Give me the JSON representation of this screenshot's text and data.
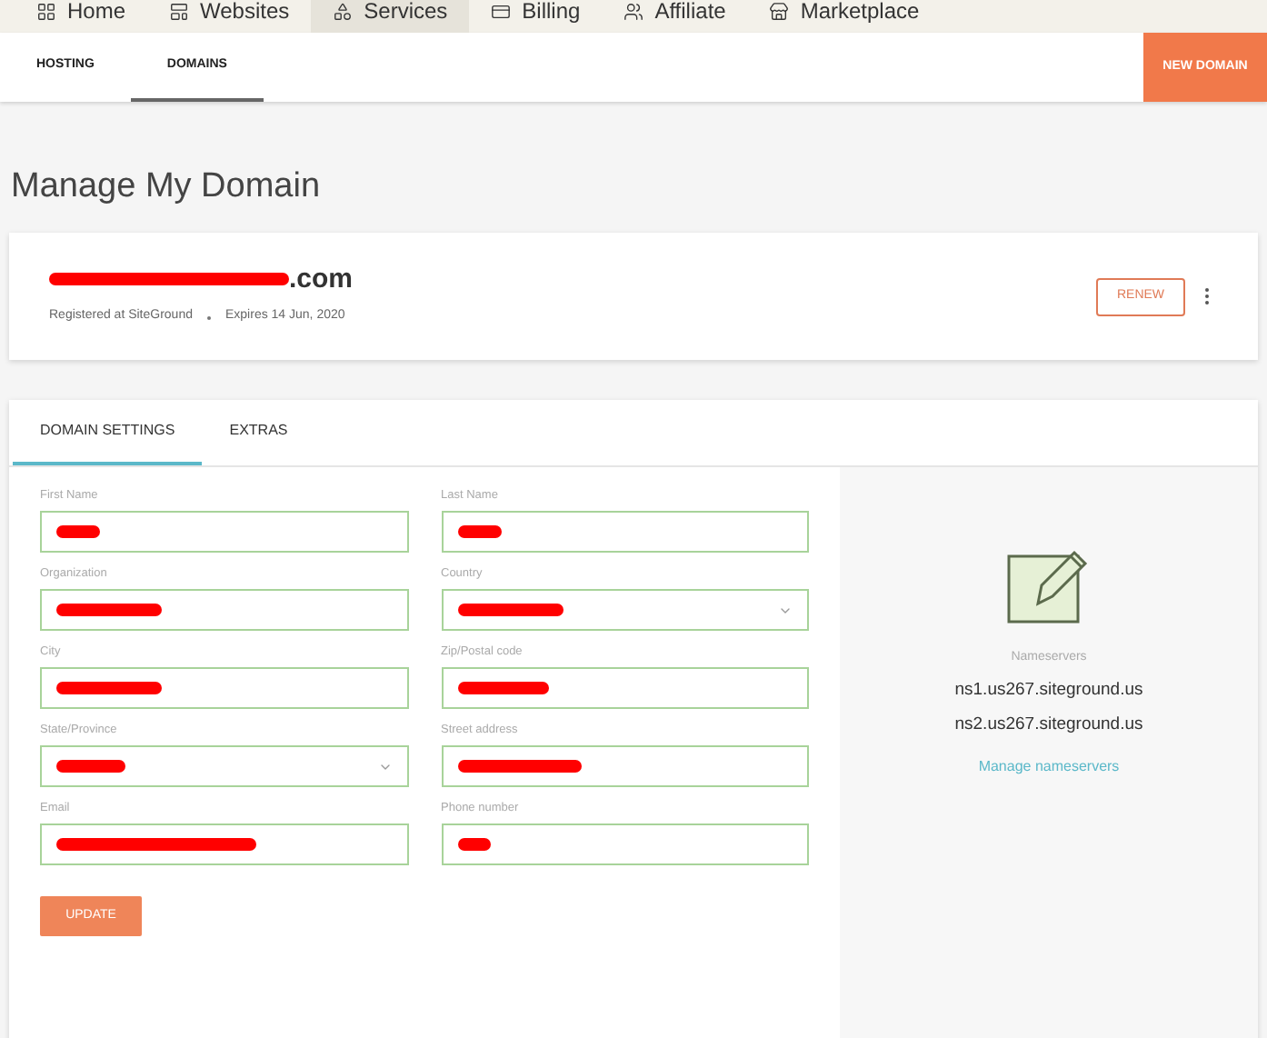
{
  "top_nav": [
    {
      "label": "Home",
      "selected": false
    },
    {
      "label": "Websites",
      "selected": false
    },
    {
      "label": "Services",
      "selected": true
    },
    {
      "label": "Billing",
      "selected": false
    },
    {
      "label": "Affiliate",
      "selected": false
    },
    {
      "label": "Marketplace",
      "selected": false
    }
  ],
  "sub_nav": {
    "tabs": [
      {
        "label": "HOSTING",
        "selected": false
      },
      {
        "label": "DOMAINS",
        "selected": true
      }
    ],
    "action": "NEW DOMAIN"
  },
  "page_title": "Manage My Domain",
  "domain_card": {
    "name": ".com",
    "redacted": true,
    "registrar": "Registered at SiteGround",
    "expires": "Expires 14 Jun, 2020",
    "action": "RENEW"
  },
  "settings_tabs": [
    {
      "label": "DOMAIN SETTINGS",
      "selected": true
    },
    {
      "label": "EXTRAS",
      "selected": false
    }
  ],
  "fields": [
    {
      "label": "First Name",
      "kind": "text",
      "redacted": true
    },
    {
      "label": "Last Name",
      "kind": "text",
      "redacted": true
    },
    {
      "label": "Organization",
      "kind": "text",
      "redacted": true
    },
    {
      "label": "Country",
      "kind": "select",
      "redacted": true
    },
    {
      "label": "City",
      "kind": "text",
      "redacted": true
    },
    {
      "label": "Zip/Postal code",
      "kind": "text",
      "redacted": true
    },
    {
      "label": "State/Province",
      "kind": "select",
      "redacted": true
    },
    {
      "label": "Street address",
      "kind": "text",
      "redacted": true
    },
    {
      "label": "Email",
      "kind": "text",
      "redacted": true
    },
    {
      "label": "Phone number",
      "kind": "text",
      "redacted": true
    }
  ],
  "update_button": "UPDATE",
  "nameservers": {
    "label": "Nameservers",
    "servers": [
      "ns1.us267.siteground.us",
      "ns2.us267.siteground.us"
    ],
    "link": "Manage nameservers"
  }
}
